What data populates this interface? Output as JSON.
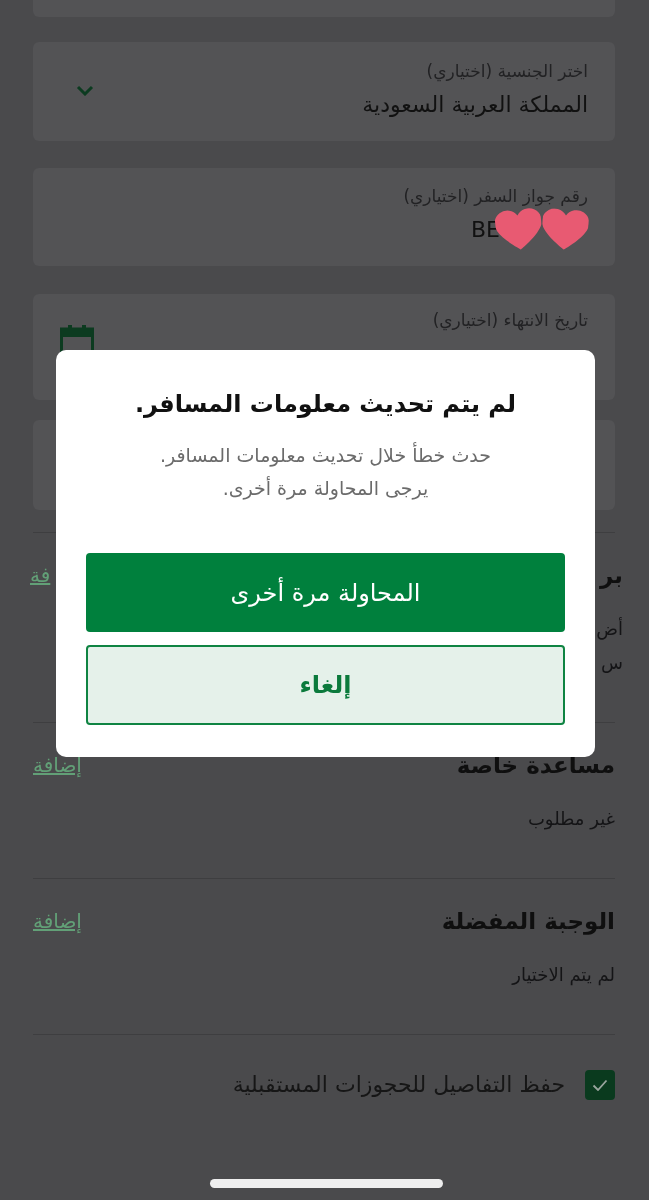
{
  "fields": [
    {
      "kind": "dropdown",
      "label": "اختر الجنسية (اختياري)",
      "value": "المملكة العربية السعودية"
    },
    {
      "kind": "text",
      "label": "رقم جواز السفر (اختياري)",
      "value": "BE",
      "covered": true
    },
    {
      "kind": "date",
      "label": "تاريخ الانتهاء (اختياري)"
    }
  ],
  "sections": [
    {
      "title": "بر",
      "lines": [
        "أض",
        "س"
      ],
      "link": "فة"
    },
    {
      "title": "مساعدة خاصة",
      "lines": [
        "غير مطلوب"
      ],
      "link": "إضافة"
    },
    {
      "title": "الوجبة المفضلة",
      "lines": [
        "لم يتم الاختيار"
      ],
      "link": "إضافة"
    }
  ],
  "save_details": {
    "label": "حفظ التفاصيل للحجوزات المستقبلية",
    "checked": true
  },
  "dialog": {
    "title": "لم يتم تحديث معلومات المسافر.",
    "message_lines": [
      "حدث خطأ خلال تحديث معلومات المسافر.",
      "يرجى المحاولة مرة أخرى."
    ],
    "buttons": [
      {
        "kind": "primary",
        "label": "المحاولة مرة أخرى"
      },
      {
        "kind": "secondary",
        "label": "إلغاء"
      }
    ]
  }
}
